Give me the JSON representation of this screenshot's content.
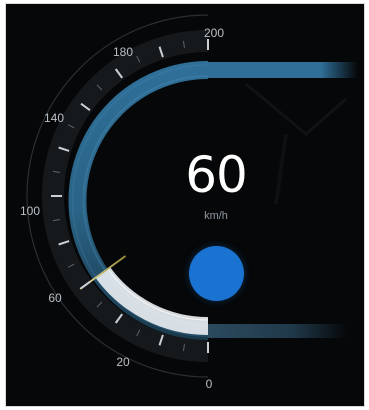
{
  "dashboard": {
    "speed_value": "60",
    "speed_unit": "km/h",
    "scale_labels": [
      "200",
      "180",
      "140",
      "100",
      "60",
      "20",
      "0"
    ],
    "current_speed_kmh": 60,
    "max_speed_kmh": 200,
    "indicator_color": "#1b73d1",
    "accent_color": "#3a7ba6"
  }
}
